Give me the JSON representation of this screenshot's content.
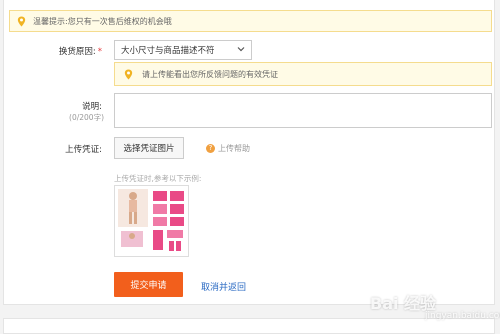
{
  "notice": {
    "text": "温馨提示:您只有一次售后维权的机会哦",
    "icon": "location-pin-icon"
  },
  "form": {
    "reason": {
      "label": "换货原因:",
      "required_mark": "*",
      "selected": "大小尺寸与商品描述不符"
    },
    "hint": {
      "text": "请上传能看出您所反馈问题的有效凭证",
      "icon": "location-pin-icon"
    },
    "description": {
      "label": "说明:",
      "counter": "(0/200字)",
      "value": ""
    },
    "proof": {
      "label": "上传凭证:",
      "button": "选择凭证图片",
      "help": "上传帮助",
      "example_caption": "上传凭证时,参考以下示例:"
    }
  },
  "actions": {
    "submit": "提交申请",
    "cancel": "取消并返回"
  },
  "watermark": {
    "text": "Bai 经验",
    "sub": "jingyan.baidu.com"
  },
  "colors": {
    "accent": "#f25f1c",
    "link": "#2a6ac3",
    "notice_bg": "#fffbe6",
    "pin": "#f0b323"
  }
}
